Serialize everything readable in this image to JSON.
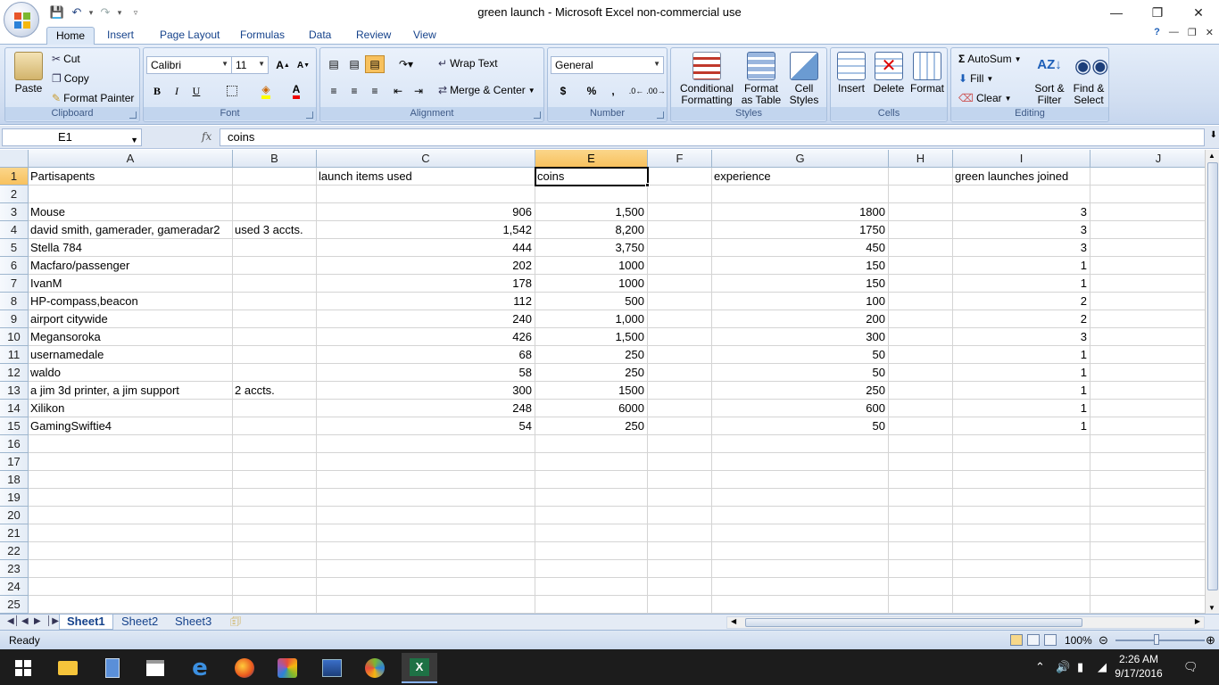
{
  "window": {
    "title": "green launch - Microsoft Excel non-commercial use",
    "controls": [
      "minimize-icon",
      "restore-icon",
      "close-icon"
    ]
  },
  "tabs": [
    "Home",
    "Insert",
    "Page Layout",
    "Formulas",
    "Data",
    "Review",
    "View"
  ],
  "active_tab": "Home",
  "ribbon": {
    "clipboard": {
      "label": "Clipboard",
      "paste": "Paste",
      "cut": "Cut",
      "copy": "Copy",
      "format_painter": "Format Painter"
    },
    "font": {
      "label": "Font",
      "name": "Calibri",
      "size": "11",
      "bold": "B",
      "italic": "I",
      "underline": "U"
    },
    "alignment": {
      "label": "Alignment",
      "wrap": "Wrap Text",
      "merge": "Merge & Center"
    },
    "number": {
      "label": "Number",
      "format": "General",
      "currency": "$",
      "percent": "%",
      "comma": ","
    },
    "styles": {
      "label": "Styles",
      "conditional": [
        "Conditional",
        "Formatting"
      ],
      "format_table": [
        "Format",
        "as Table"
      ],
      "cell_styles": [
        "Cell",
        "Styles"
      ]
    },
    "cells": {
      "label": "Cells",
      "insert": "Insert",
      "delete": "Delete",
      "format": "Format"
    },
    "editing": {
      "label": "Editing",
      "autosum": "AutoSum",
      "fill": "Fill",
      "clear": "Clear",
      "sort": [
        "Sort &",
        "Filter"
      ],
      "find": [
        "Find &",
        "Select"
      ]
    }
  },
  "formula_bar": {
    "name_box": "E1",
    "fx": "fx",
    "value": "coins"
  },
  "columns": [
    {
      "id": "A",
      "w": 229
    },
    {
      "id": "B",
      "w": 94
    },
    {
      "id": "C",
      "w": 245
    },
    {
      "id": "E",
      "w": 126
    },
    {
      "id": "F",
      "w": 72
    },
    {
      "id": "G",
      "w": 198
    },
    {
      "id": "H",
      "w": 72
    },
    {
      "id": "I",
      "w": 154
    },
    {
      "id": "J",
      "w": 153
    }
  ],
  "selected_column": "E",
  "selected_row": "1",
  "rows": [
    {
      "n": "1",
      "cells": [
        "Partisapents",
        "",
        "launch items used",
        "coins",
        "",
        "experience",
        "",
        "green launches joined",
        ""
      ]
    },
    {
      "n": "2",
      "cells": [
        "",
        "",
        "",
        "",
        "",
        "",
        "",
        "",
        ""
      ]
    },
    {
      "n": "3",
      "cells": [
        "Mouse",
        "",
        "906",
        "1,500",
        "",
        "1800",
        "",
        "3",
        ""
      ]
    },
    {
      "n": "4",
      "cells": [
        "david smith, gamerader, gameradar2",
        "used 3 accts.",
        "1,542",
        "8,200",
        "",
        "1750",
        "",
        "3",
        ""
      ]
    },
    {
      "n": "5",
      "cells": [
        "Stella 784",
        "",
        "444",
        "3,750",
        "",
        "450",
        "",
        "3",
        ""
      ]
    },
    {
      "n": "6",
      "cells": [
        "Macfaro/passenger",
        "",
        "202",
        "1000",
        "",
        "150",
        "",
        "1",
        ""
      ]
    },
    {
      "n": "7",
      "cells": [
        "IvanM",
        "",
        "178",
        "1000",
        "",
        "150",
        "",
        "1",
        ""
      ]
    },
    {
      "n": "8",
      "cells": [
        "HP-compass,beacon",
        "",
        "112",
        "500",
        "",
        "100",
        "",
        "2",
        ""
      ]
    },
    {
      "n": "9",
      "cells": [
        "airport citywide",
        "",
        "240",
        "1,000",
        "",
        "200",
        "",
        "2",
        ""
      ]
    },
    {
      "n": "10",
      "cells": [
        "Megansoroka",
        "",
        "426",
        "1,500",
        "",
        "300",
        "",
        "3",
        ""
      ]
    },
    {
      "n": "11",
      "cells": [
        "usernamedale",
        "",
        "68",
        "250",
        "",
        "50",
        "",
        "1",
        ""
      ]
    },
    {
      "n": "12",
      "cells": [
        "waldo",
        "",
        "58",
        "250",
        "",
        "50",
        "",
        "1",
        ""
      ]
    },
    {
      "n": "13",
      "cells": [
        "a jim 3d printer, a jim support",
        "2 accts.",
        "300",
        "1500",
        "",
        "250",
        "",
        "1",
        ""
      ]
    },
    {
      "n": "14",
      "cells": [
        "Xilikon",
        "",
        "248",
        "6000",
        "",
        "600",
        "",
        "1",
        ""
      ]
    },
    {
      "n": "15",
      "cells": [
        "GamingSwiftie4",
        "",
        "54",
        "250",
        "",
        "50",
        "",
        "1",
        ""
      ]
    },
    {
      "n": "16",
      "cells": [
        "",
        "",
        "",
        "",
        "",
        "",
        "",
        "",
        ""
      ]
    },
    {
      "n": "17",
      "cells": [
        "",
        "",
        "",
        "",
        "",
        "",
        "",
        "",
        ""
      ]
    },
    {
      "n": "18",
      "cells": [
        "",
        "",
        "",
        "",
        "",
        "",
        "",
        "",
        ""
      ]
    },
    {
      "n": "19",
      "cells": [
        "",
        "",
        "",
        "",
        "",
        "",
        "",
        "",
        ""
      ]
    },
    {
      "n": "20",
      "cells": [
        "",
        "",
        "",
        "",
        "",
        "",
        "",
        "",
        ""
      ]
    },
    {
      "n": "21",
      "cells": [
        "",
        "",
        "",
        "",
        "",
        "",
        "",
        "",
        ""
      ]
    },
    {
      "n": "22",
      "cells": [
        "",
        "",
        "",
        "",
        "",
        "",
        "",
        "",
        ""
      ]
    },
    {
      "n": "23",
      "cells": [
        "",
        "",
        "",
        "",
        "",
        "",
        "",
        "",
        ""
      ]
    },
    {
      "n": "24",
      "cells": [
        "",
        "",
        "",
        "",
        "",
        "",
        "",
        "",
        ""
      ]
    },
    {
      "n": "25",
      "cells": [
        "",
        "",
        "",
        "",
        "",
        "",
        "",
        "",
        ""
      ]
    }
  ],
  "sheets": [
    "Sheet1",
    "Sheet2",
    "Sheet3"
  ],
  "active_sheet": "Sheet1",
  "status": {
    "text": "Ready",
    "zoom": "100%"
  },
  "clock": {
    "time": "2:26 AM",
    "date": "9/17/2016"
  },
  "colors": {
    "accent": "#15428b",
    "selection": "#f7c15e",
    "taskbar": "#1c1c1c"
  }
}
